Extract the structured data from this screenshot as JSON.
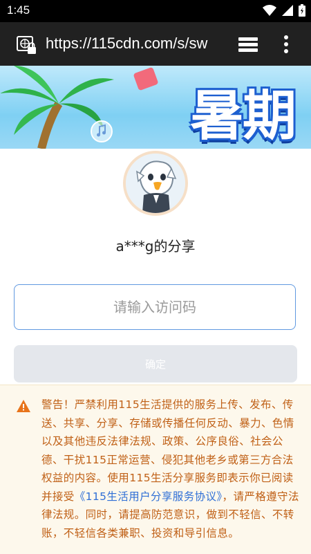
{
  "status_bar": {
    "time": "1:45"
  },
  "browser": {
    "url": "https://115cdn.com/s/sw"
  },
  "banner": {
    "title": "暑期"
  },
  "share": {
    "title": "a***g的分享",
    "input_placeholder": "请输入访问码",
    "input_value": "",
    "confirm_label": "确定"
  },
  "warning": {
    "text_before": "警告！严禁利用115生活提供的服务上传、发布、传送、共享、分享、存储或传播任何反动、暴力、色情以及其他违反法律法规、政策、公序良俗、社会公德、干扰115正常运营、侵犯其他老乡或第三方合法权益的内容。使用115生活分享服务即表示你已阅读并接受",
    "link_text": "《115生活用户分享服务协议》",
    "text_after": "，请严格遵守法律法规。同时，请提高防范意识，做到不轻信、不转账，不轻信各类兼职、投资和导引信息。"
  },
  "colors": {
    "accent": "#5f98e0",
    "warning_text": "#c06016",
    "warning_bg": "#fdf8ec",
    "link": "#2f6fd6"
  }
}
